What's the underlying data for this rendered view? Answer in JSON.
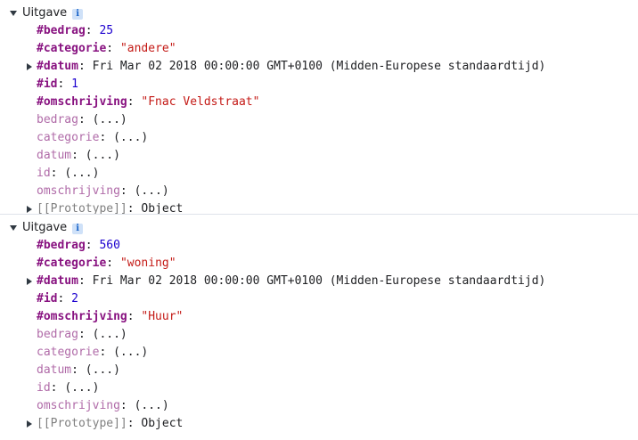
{
  "entries": [
    {
      "class_name": "Uitgave",
      "info_glyph": "i",
      "own_props": [
        {
          "key": "#bedrag",
          "value": "25",
          "kind": "number"
        },
        {
          "key": "#categorie",
          "value": "\"andere\"",
          "kind": "string"
        },
        {
          "key": "#datum",
          "value": "Fri Mar 02 2018 00:00:00 GMT+0100 (Midden-Europese standaardtijd)",
          "kind": "date"
        },
        {
          "key": "#id",
          "value": "1",
          "kind": "number"
        },
        {
          "key": "#omschrijving",
          "value": "\"Fnac Veldstraat\"",
          "kind": "string"
        }
      ],
      "accessors": [
        {
          "key": "bedrag",
          "value": "(...)"
        },
        {
          "key": "categorie",
          "value": "(...)"
        },
        {
          "key": "datum",
          "value": "(...)"
        },
        {
          "key": "id",
          "value": "(...)"
        },
        {
          "key": "omschrijving",
          "value": "(...)"
        }
      ],
      "prototype": {
        "key": "[[Prototype]]",
        "value": "Object"
      }
    },
    {
      "class_name": "Uitgave",
      "info_glyph": "i",
      "own_props": [
        {
          "key": "#bedrag",
          "value": "560",
          "kind": "number"
        },
        {
          "key": "#categorie",
          "value": "\"woning\"",
          "kind": "string"
        },
        {
          "key": "#datum",
          "value": "Fri Mar 02 2018 00:00:00 GMT+0100 (Midden-Europese standaardtijd)",
          "kind": "date"
        },
        {
          "key": "#id",
          "value": "2",
          "kind": "number"
        },
        {
          "key": "#omschrijving",
          "value": "\"Huur\"",
          "kind": "string"
        }
      ],
      "accessors": [
        {
          "key": "bedrag",
          "value": "(...)"
        },
        {
          "key": "categorie",
          "value": "(...)"
        },
        {
          "key": "datum",
          "value": "(...)"
        },
        {
          "key": "id",
          "value": "(...)"
        },
        {
          "key": "omschrijving",
          "value": "(...)"
        }
      ],
      "prototype": {
        "key": "[[Prototype]]",
        "value": "Object"
      }
    }
  ],
  "colors": {
    "own_key": "#881280",
    "accessor_key": "#b06ba8",
    "number": "#1c00cf",
    "string": "#c41a16",
    "prototype_key": "#7f7f7f",
    "info_badge_bg": "#cfe1f8",
    "info_badge_fg": "#1a63c8"
  },
  "icons": {
    "expanded": "triangle-down-icon",
    "collapsed": "triangle-right-icon",
    "info": "info-icon"
  }
}
